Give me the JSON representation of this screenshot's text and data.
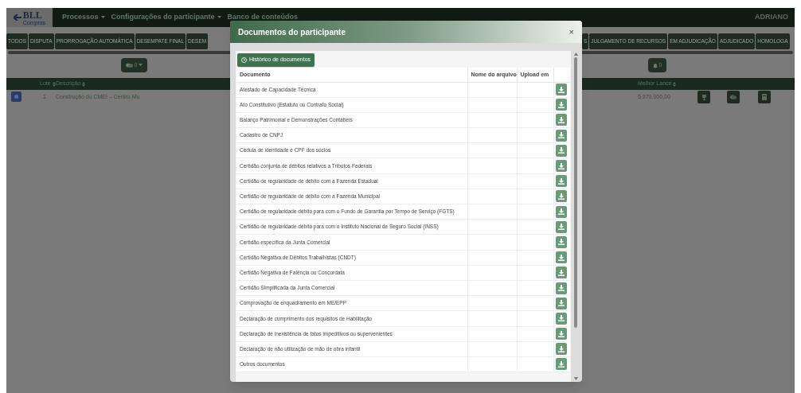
{
  "navbar": {
    "logo": "BLL",
    "logo_sub": "Compras",
    "menu": [
      {
        "label": "Processos",
        "dropdown": true
      },
      {
        "label": "Configurações do participante",
        "dropdown": true
      },
      {
        "label": "Banco de conteúdos",
        "dropdown": false
      }
    ],
    "user": "ADRIANO"
  },
  "tabs_left": [
    "TODOS",
    "DISPUTA",
    "PRORROGAÇÃO AUTOMÁTICA",
    "DESEMPATE FINAL",
    "DESEM"
  ],
  "tabs_right": [
    "S",
    "JULGAMENTO DE RECURSOS",
    "EM ADJUDICAÇÃO",
    "ADJUDICADO",
    "HOMOLOGA"
  ],
  "chat_button": "0",
  "bell_button": "0",
  "table": {
    "columns": [
      "Lote",
      "Descrição",
      "Melhor Lance"
    ],
    "rows": [
      {
        "lote": "1",
        "descricao": "Construção do CMEI – Centro Mu",
        "melhor_lance": "5.970.000,00"
      }
    ]
  },
  "modal": {
    "title": "Documentos do participante",
    "close": "×",
    "history_button": "Histórico de documentos",
    "columns": [
      "Documento",
      "Nome do arquivo",
      "Upload em"
    ],
    "documents": [
      "Atestado de Capacidade Técnica",
      "Ato Constitutivo (Estatuto ou Contrato Social)",
      "Balanço Patrimonial e Demonstrações Contábeis",
      "Cadastro de CNPJ",
      "Cédula de identidade e CPF dos sócios",
      "Certidão conjunta de débitos relativos a Tributos Federais",
      "Certidão de regularidade de débito com a Fazenda Estadual",
      "Certidão de regularidade de débito com a Fazenda Municipal",
      "Certidão de regularidade débito para com o Fundo de Garantia por Tempo de Serviço (FGTS)",
      "Certidão de regularidade débito para com o Instituto Nacional de Seguro Social (INSS)",
      "Certidão específica da Junta Comercial",
      "Certidão Negativa de Débitos Trabalhistas (CNDT)",
      "Certidão Negativa de Falência ou Concordata",
      "Certidão Simplificada da Junta Comercial",
      "Comprovação de enquadramento em ME/EPP",
      "Declaração de cumprimento dos requisitos de Habilitação",
      "Declaração de inexistência de fatos impeditivos ou supervenientes",
      "Declaração de não utilização de mão de obra infantil",
      "Outros documentos"
    ]
  }
}
